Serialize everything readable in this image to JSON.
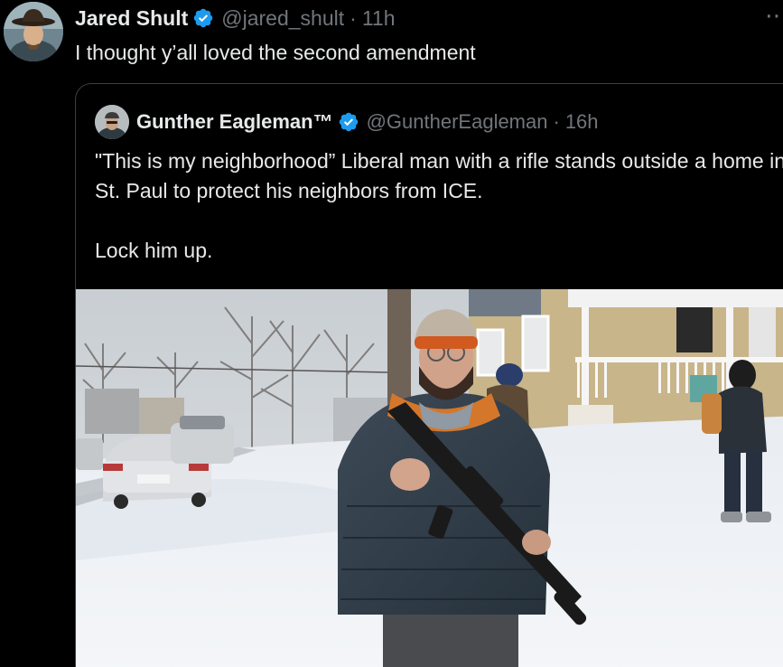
{
  "tweet": {
    "author": {
      "display_name": "Jared Shult",
      "handle": "@jared_shult",
      "time": "11h",
      "verified": true
    },
    "text": "I thought y’all loved the second amendment",
    "separator": "·"
  },
  "quoted_tweet": {
    "author": {
      "display_name": "Gunther Eagleman™",
      "handle": "@GuntherEagleman",
      "time": "16h",
      "verified": true
    },
    "separator": "·",
    "text_lines": [
      "\"This is my neighborhood” Liberal man with a rifle stands outside a home in St. Paul to protect his neighbors from ICE.",
      "Lock him up."
    ],
    "media": {
      "type": "photo"
    }
  },
  "colors": {
    "background": "#000000",
    "text_primary": "#e7e9ea",
    "text_secondary": "#71767b",
    "verified_badge": "#1d9bf0",
    "card_border": "#3a3f44"
  },
  "icons": {
    "verified": "verified-badge-icon",
    "more": "more-icon"
  }
}
